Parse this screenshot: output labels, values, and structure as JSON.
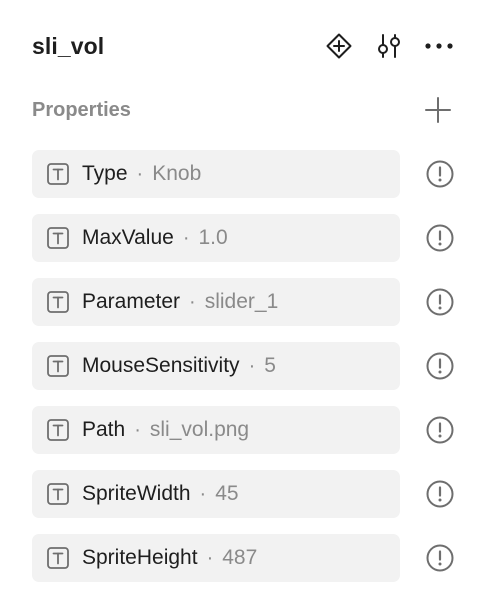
{
  "panel": {
    "title": "sli_vol",
    "icons": [
      "component-diamond-plus-icon",
      "adjust-sliders-icon",
      "more-dots-icon"
    ]
  },
  "properties": {
    "label": "Properties",
    "add_icon": "plus-icon",
    "separator": "·",
    "item_icon": "text-type-icon",
    "status_icon": "warning-circle-icon",
    "items": [
      {
        "name": "Type",
        "value": "Knob"
      },
      {
        "name": "MaxValue",
        "value": "1.0"
      },
      {
        "name": "Parameter",
        "value": "slider_1"
      },
      {
        "name": "MouseSensitivity",
        "value": "5"
      },
      {
        "name": "Path",
        "value": "sli_vol.png"
      },
      {
        "name": "SpriteWidth",
        "value": "45"
      },
      {
        "name": "SpriteHeight",
        "value": "487"
      }
    ]
  },
  "colors": {
    "text": "#1e1e1e",
    "muted": "#8a8a8a",
    "row_bg": "#f2f2f2",
    "icon": "#6e6e6e"
  }
}
